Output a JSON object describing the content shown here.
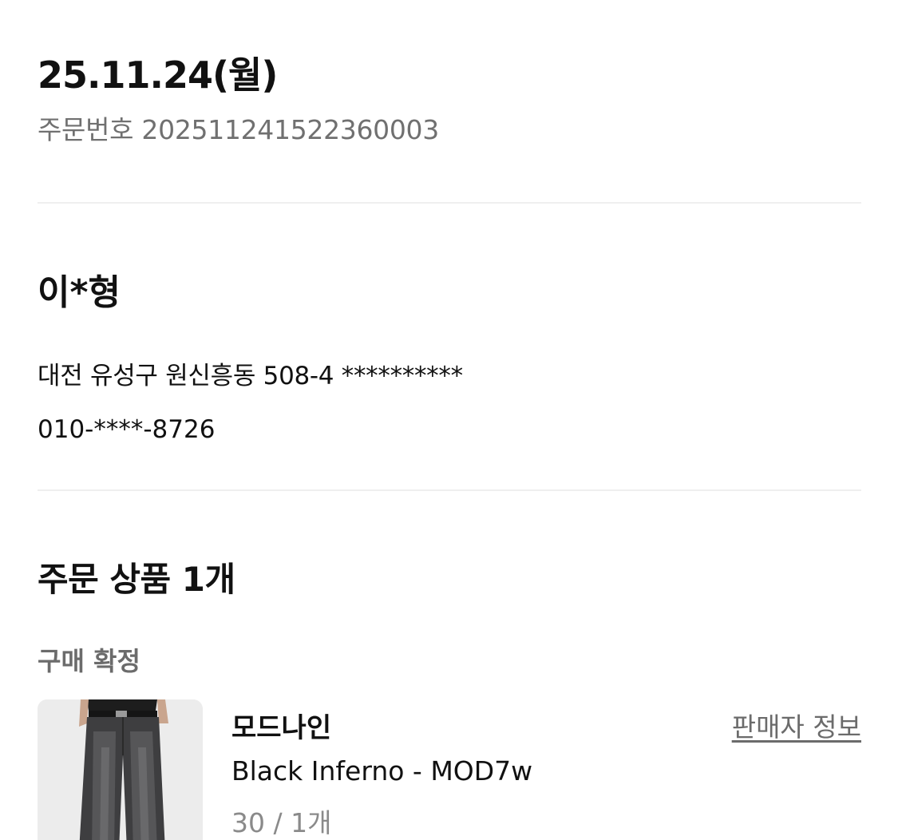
{
  "order": {
    "date": "25.11.24(월)",
    "number_text": "주문번호 20251124152236000​3"
  },
  "shipping": {
    "recipient_name": "이*형",
    "address": "대전 유성구 원신흥동 508-4 **********",
    "phone": "010-****-8726"
  },
  "products": {
    "title": "주문 상품 1개",
    "status": "구매 확정",
    "items": [
      {
        "brand": "모드나인",
        "seller_info_label": "판매자 정보",
        "name": "Black Inferno - MOD7w",
        "option": "30 / 1개",
        "thumbnail_icon": "jeans-product-image"
      }
    ]
  }
}
